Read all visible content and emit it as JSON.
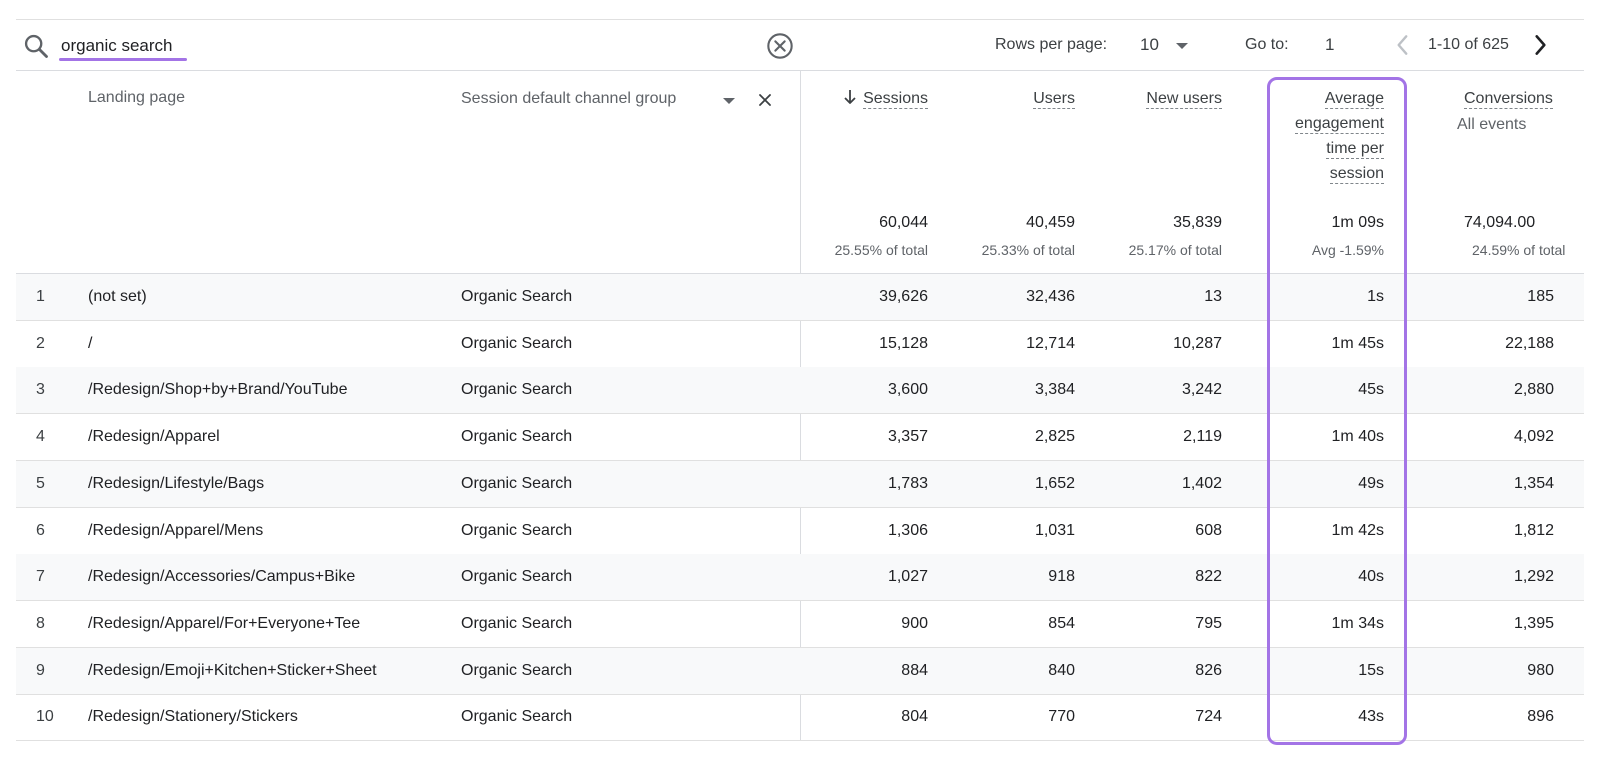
{
  "search": {
    "value": "organic search",
    "placeholder": ""
  },
  "pagination": {
    "rows_per_page_label": "Rows per page:",
    "rows_per_page_value": "10",
    "goto_label": "Go to:",
    "goto_value": "1",
    "range_label": "1-10 of 625"
  },
  "columns": {
    "landing_page": "Landing page",
    "channel_group": "Session default channel group",
    "sessions": "Sessions",
    "users": "Users",
    "new_users": "New users",
    "avg_engagement": [
      "Average",
      "engagement",
      "time per",
      "session"
    ],
    "conversions": "Conversions",
    "conversions_sub": "All events"
  },
  "totals": {
    "sessions": "60,044",
    "sessions_sub": "25.55% of total",
    "users": "40,459",
    "users_sub": "25.33% of total",
    "new_users": "35,839",
    "new_users_sub": "25.17% of total",
    "avg_engagement": "1m 09s",
    "avg_engagement_sub": "Avg -1.59%",
    "conversions": "74,094.00",
    "conversions_sub": "24.59% of total"
  },
  "rows": [
    {
      "n": "1",
      "page": "(not set)",
      "channel": "Organic Search",
      "sessions": "39,626",
      "users": "32,436",
      "new_users": "13",
      "avg": "1s",
      "conv": "185"
    },
    {
      "n": "2",
      "page": "/",
      "channel": "Organic Search",
      "sessions": "15,128",
      "users": "12,714",
      "new_users": "10,287",
      "avg": "1m 45s",
      "conv": "22,188"
    },
    {
      "n": "3",
      "page": "/Redesign/Shop+by+Brand/YouTube",
      "channel": "Organic Search",
      "sessions": "3,600",
      "users": "3,384",
      "new_users": "3,242",
      "avg": "45s",
      "conv": "2,880"
    },
    {
      "n": "4",
      "page": "/Redesign/Apparel",
      "channel": "Organic Search",
      "sessions": "3,357",
      "users": "2,825",
      "new_users": "2,119",
      "avg": "1m 40s",
      "conv": "4,092"
    },
    {
      "n": "5",
      "page": "/Redesign/Lifestyle/Bags",
      "channel": "Organic Search",
      "sessions": "1,783",
      "users": "1,652",
      "new_users": "1,402",
      "avg": "49s",
      "conv": "1,354"
    },
    {
      "n": "6",
      "page": "/Redesign/Apparel/Mens",
      "channel": "Organic Search",
      "sessions": "1,306",
      "users": "1,031",
      "new_users": "608",
      "avg": "1m 42s",
      "conv": "1,812"
    },
    {
      "n": "7",
      "page": "/Redesign/Accessories/Campus+Bike",
      "channel": "Organic Search",
      "sessions": "1,027",
      "users": "918",
      "new_users": "822",
      "avg": "40s",
      "conv": "1,292"
    },
    {
      "n": "8",
      "page": "/Redesign/Apparel/For+Everyone+Tee",
      "channel": "Organic Search",
      "sessions": "900",
      "users": "854",
      "new_users": "795",
      "avg": "1m 34s",
      "conv": "1,395"
    },
    {
      "n": "9",
      "page": "/Redesign/Emoji+Kitchen+Sticker+Sheet",
      "channel": "Organic Search",
      "sessions": "884",
      "users": "840",
      "new_users": "826",
      "avg": "15s",
      "conv": "980"
    },
    {
      "n": "10",
      "page": "/Redesign/Stationery/Stickers",
      "channel": "Organic Search",
      "sessions": "804",
      "users": "770",
      "new_users": "724",
      "avg": "43s",
      "conv": "896"
    }
  ],
  "colors": {
    "highlight": "#a374e6",
    "row_alt": "#f8f9fa",
    "divider": "#dadce0"
  }
}
